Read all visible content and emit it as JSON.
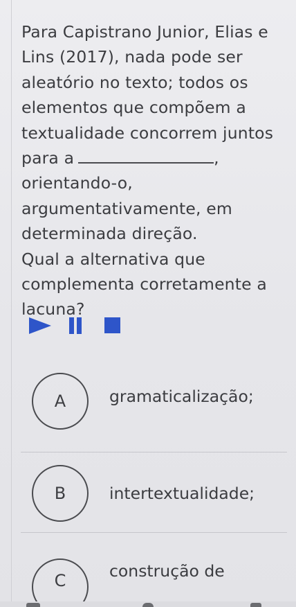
{
  "question": {
    "lines_part1": "Para Capistrano Junior, Elias e Lins (2017), nada pode ser aleatório no texto; todos os elementos que compõem a textualidade concorrem juntos para a",
    "after_blank": ",",
    "lines_part2": "orientando-o, argumentativamente, em determinada direção.",
    "prompt": "Qual a alternativa que complementa corretamente a lacuna?"
  },
  "player": {
    "play_icon": "play-icon",
    "pause_icon": "pause-icon",
    "stop_icon": "stop-icon",
    "accent_color": "#2e55c9"
  },
  "options": [
    {
      "letter": "A",
      "text": "gramaticalização;"
    },
    {
      "letter": "B",
      "text": "intertextualidade;"
    },
    {
      "letter": "C",
      "text": "construção de"
    }
  ]
}
